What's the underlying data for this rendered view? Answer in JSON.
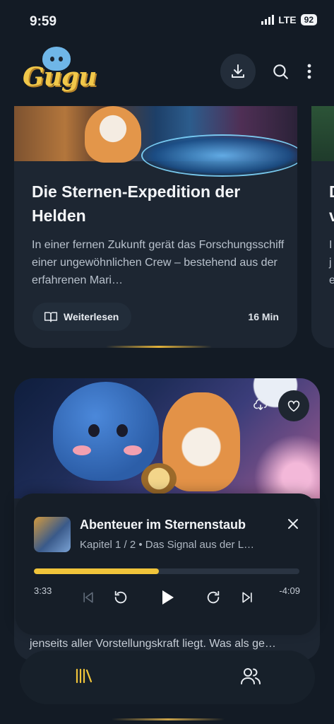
{
  "status": {
    "time": "9:59",
    "network": "LTE",
    "battery": "92"
  },
  "header": {
    "logo_text": "Gugu",
    "icons": [
      "download-icon",
      "search-icon",
      "more-vertical-icon"
    ]
  },
  "story_card": {
    "title": "Die Sternen-Expedition der Helden",
    "description": "In einer fernen Zukunft gerät das Forschungsschiff einer ungewöhnlichen Crew – bestehend aus der erfahrenen Mari…",
    "read_label": "Weiterlesen",
    "duration": "16 Min"
  },
  "peek_card": {
    "title_line1": "D",
    "title_line2": "v",
    "desc_line1": "I",
    "desc_line2": "j",
    "desc_line3": "e"
  },
  "story_card_2": {
    "visible_text": "jenseits aller Vorstellungskraft liegt. Was als ge…"
  },
  "player": {
    "title": "Abenteuer im Sternenstaub",
    "subtitle": "Kapitel 1 / 2 • Das Signal aus der L…",
    "elapsed": "3:33",
    "remaining": "-4:09",
    "progress": 0.47
  },
  "colors": {
    "accent": "#f0c43a",
    "background": "#131b25",
    "card": "#1d2632"
  }
}
